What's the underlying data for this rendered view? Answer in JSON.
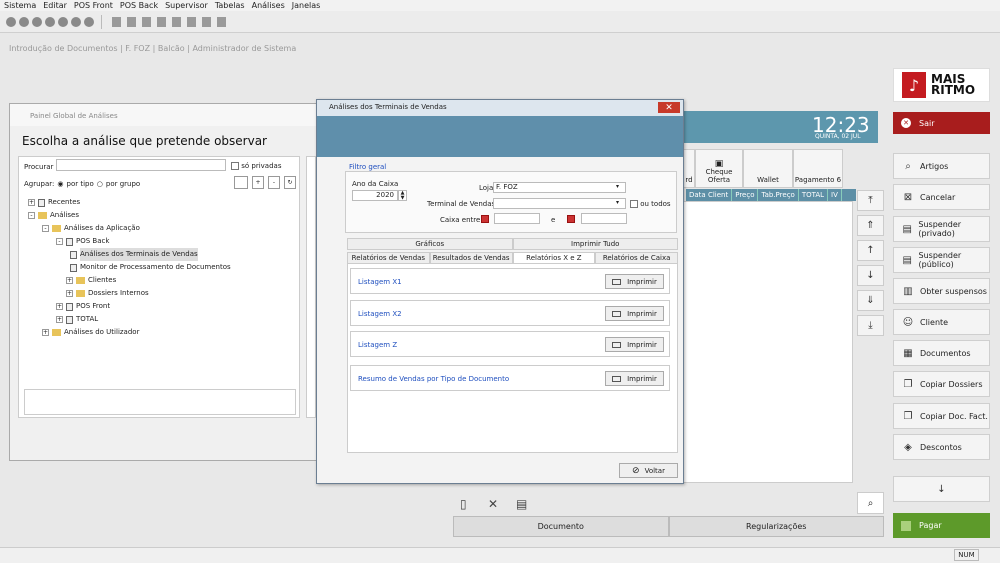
{
  "menu": [
    "Sistema",
    "Editar",
    "POS Front",
    "POS Back",
    "Supervisor",
    "Tabelas",
    "Análises",
    "Janelas"
  ],
  "breadcrumb": "Introdução de Documentos | F. FOZ | Balcão | Administrador de Sistema",
  "logo": {
    "line1": "MAIS",
    "line2": "RITMO",
    "glyph": "♪"
  },
  "clock": {
    "time": "12:23",
    "date": "QUINTA, 02 JUL"
  },
  "right_buttons": {
    "sair": "Sair",
    "artigos": "Artigos",
    "cancelar": "Cancelar",
    "susp_priv": "Suspender (privado)",
    "susp_pub": "Suspender (público)",
    "obter": "Obter suspensos",
    "cliente": "Cliente",
    "documentos": "Documentos",
    "copiar_dossiers": "Copiar Dossiers",
    "copiar_doc": "Copiar Doc. Fact.",
    "descontos": "Descontos",
    "pagar": "Pagar"
  },
  "pay_tabs": [
    "rd",
    "Cheque Oferta",
    "Wallet",
    "Pagamento 6"
  ],
  "col_headers": [
    "Data Client",
    "Preço",
    "Tab.Preço",
    "TOTAL",
    "IV"
  ],
  "bottom": {
    "documento": "Documento",
    "regularizacoes": "Regularizações"
  },
  "status": {
    "num": "NUM"
  },
  "painel": {
    "title": "Painel Global de Análises",
    "heading": "Escolha a análise que pretende observar",
    "procurar": "Procurar :",
    "so_privadas": "só privadas",
    "agrupar": "Agrupar:",
    "por_tipo": "por tipo",
    "por_grupo": "por grupo",
    "tree": {
      "recentes": "Recentes",
      "analises": "Análises",
      "aplicacao": "Análises da Aplicação",
      "posback": "POS Back",
      "terminais": "Análises dos Terminais de Vendas",
      "monitor": "Monitor de Processamento de Documentos",
      "clientes": "Clientes",
      "dossiers": "Dossiers Internos",
      "posfront": "POS Front",
      "total": "TOTAL",
      "utilizador": "Análises do Utilizador"
    }
  },
  "dialog": {
    "title": "Análises dos Terminais de Vendas",
    "filtro": "Filtro geral",
    "ano_label": "Ano da Caixa",
    "ano_value": "2020",
    "loja_label": "Loja",
    "loja_value": "F. FOZ",
    "terminal_label": "Terminal de Vendas",
    "ou_todos": "ou todos",
    "caixa_entre": "Caixa entre",
    "e": "e",
    "tabs_top": [
      "Gráficos",
      "Imprimir Tudo"
    ],
    "tabs_bottom": [
      "Relatórios de Vendas",
      "Resultados de Vendas",
      "Relatórios X e Z",
      "Relatórios de Caixa"
    ],
    "listings": [
      "Listagem X1",
      "Listagem X2",
      "Listagem Z",
      "Resumo de Vendas por Tipo de Documento"
    ],
    "imprimir": "Imprimir",
    "voltar": "Voltar"
  }
}
